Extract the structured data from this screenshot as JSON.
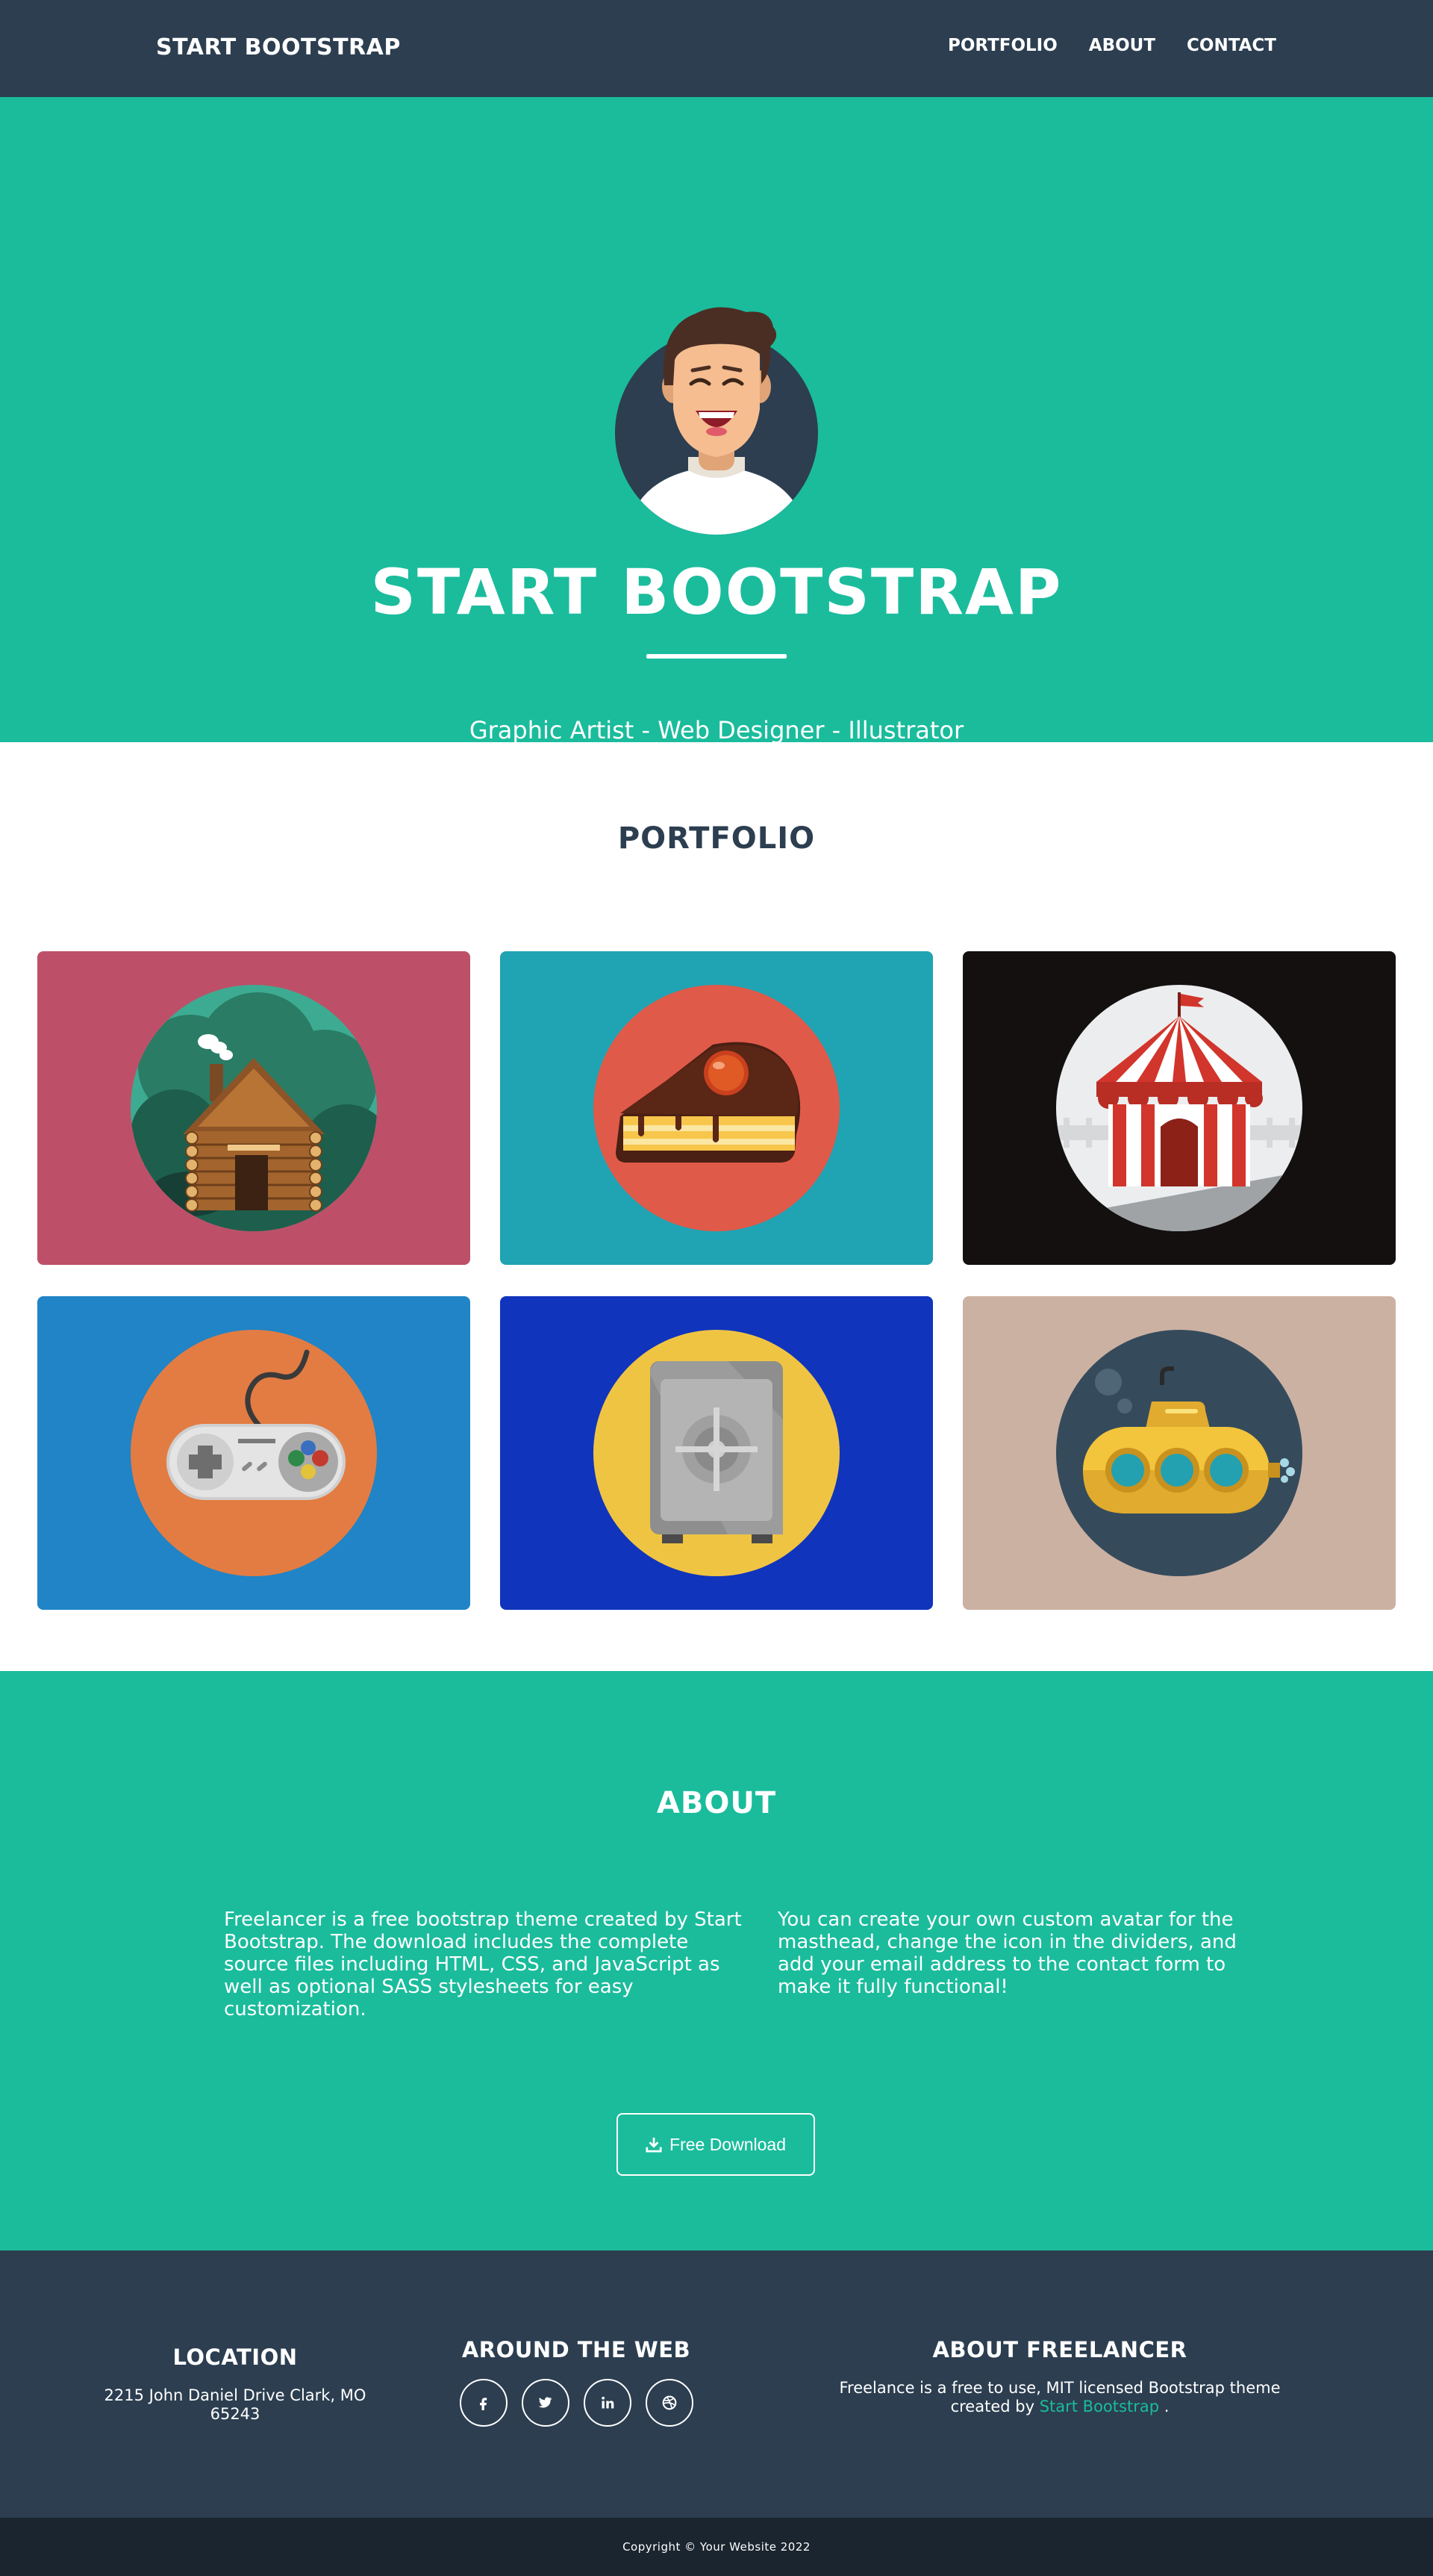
{
  "navbar": {
    "brand": "START BOOTSTRAP",
    "links": [
      "PORTFOLIO",
      "ABOUT",
      "CONTACT"
    ]
  },
  "masthead": {
    "title": "START BOOTSTRAP",
    "subtitle": "Graphic Artist - Web Designer - Illustrator"
  },
  "portfolio": {
    "title": "PORTFOLIO",
    "items": [
      {
        "name": "cabin",
        "bg": "#bd5068",
        "icon": "cabin-icon"
      },
      {
        "name": "cake",
        "bg": "#20a3b3",
        "icon": "cake-icon"
      },
      {
        "name": "circus",
        "bg": "#141010",
        "icon": "circus-tent-icon"
      },
      {
        "name": "game",
        "bg": "#2084c6",
        "icon": "game-controller-icon"
      },
      {
        "name": "safe",
        "bg": "#1034bc",
        "icon": "safe-icon"
      },
      {
        "name": "submarine",
        "bg": "#cbb1a2",
        "icon": "submarine-icon"
      }
    ]
  },
  "about": {
    "title": "ABOUT",
    "left_text": "Freelancer is a free bootstrap theme created by Start Bootstrap. The download includes the complete source files including HTML, CSS, and JavaScript as well as optional SASS stylesheets for easy customization.",
    "right_text": "You can create your own custom avatar for the masthead, change the icon in the dividers, and add your email address to the contact form to make it fully functional!",
    "download_label": "Free Download"
  },
  "footer": {
    "location_title": "LOCATION",
    "location_text": "2215 John Daniel Drive Clark, MO 65243",
    "web_title": "AROUND THE WEB",
    "socials": [
      "facebook-icon",
      "twitter-icon",
      "linkedin-icon",
      "dribbble-icon"
    ],
    "about_title": "ABOUT FREELANCER",
    "about_text_prefix": "Freelance is a free to use, MIT licensed Bootstrap theme created by",
    "about_link": "Start Bootstrap",
    "about_text_suffix": "."
  },
  "copyright": "Copyright © Your Website 2022",
  "colors": {
    "primary": "#2c3e50",
    "accent": "#1abc9c",
    "copyright_bg": "#1a252f"
  }
}
